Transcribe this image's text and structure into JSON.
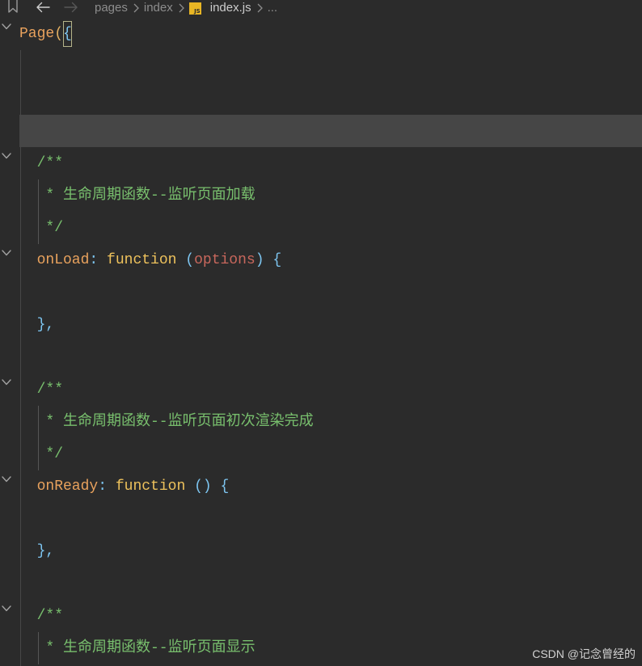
{
  "topbar": {
    "forward_enabled": false,
    "breadcrumb": {
      "folder": "pages",
      "subfolder": "index",
      "file": "index.js",
      "file_icon_text": "JS",
      "more": "..."
    }
  },
  "icons": {
    "bookmark": "bookmark-icon",
    "back": "back-arrow-icon",
    "forward": "forward-arrow-icon",
    "breadcrumb_separator": "chevron-right-icon",
    "file": "js-file-icon",
    "fold": "chevron-down-icon"
  },
  "editor": {
    "lines": [
      {
        "fold": "expanded",
        "tokens": [
          {
            "type": "identifier",
            "text": "Page"
          },
          {
            "type": "paren",
            "text": "("
          },
          {
            "type": "punctuation",
            "text": "{",
            "bracket_match": true
          }
        ]
      },
      {
        "tokens": []
      },
      {
        "tokens": []
      },
      {
        "current": true,
        "tokens": []
      },
      {
        "fold": "expanded",
        "tokens": [
          {
            "type": "comment",
            "text": "  /**"
          }
        ]
      },
      {
        "tokens": [
          {
            "type": "comment",
            "text": "   * 生命周期函数--监听页面加载"
          }
        ]
      },
      {
        "tokens": [
          {
            "type": "comment",
            "text": "   */"
          }
        ]
      },
      {
        "fold": "expanded",
        "tokens": [
          {
            "type": "identifier",
            "text": "  onLoad"
          },
          {
            "type": "punctuation",
            "text": ":"
          },
          {
            "type": "plain",
            "text": " "
          },
          {
            "type": "keyword",
            "text": "function"
          },
          {
            "type": "plain",
            "text": " "
          },
          {
            "type": "punctuation",
            "text": "("
          },
          {
            "type": "parameter",
            "text": "options"
          },
          {
            "type": "punctuation",
            "text": ")"
          },
          {
            "type": "plain",
            "text": " "
          },
          {
            "type": "punctuation",
            "text": "{"
          }
        ]
      },
      {
        "tokens": []
      },
      {
        "tokens": [
          {
            "type": "punctuation",
            "text": "  },"
          }
        ]
      },
      {
        "tokens": []
      },
      {
        "fold": "expanded",
        "tokens": [
          {
            "type": "comment",
            "text": "  /**"
          }
        ]
      },
      {
        "tokens": [
          {
            "type": "comment",
            "text": "   * 生命周期函数--监听页面初次渲染完成"
          }
        ]
      },
      {
        "tokens": [
          {
            "type": "comment",
            "text": "   */"
          }
        ]
      },
      {
        "fold": "expanded",
        "tokens": [
          {
            "type": "identifier",
            "text": "  onReady"
          },
          {
            "type": "punctuation",
            "text": ":"
          },
          {
            "type": "plain",
            "text": " "
          },
          {
            "type": "keyword",
            "text": "function"
          },
          {
            "type": "plain",
            "text": " "
          },
          {
            "type": "punctuation",
            "text": "()"
          },
          {
            "type": "plain",
            "text": " "
          },
          {
            "type": "punctuation",
            "text": "{"
          }
        ]
      },
      {
        "tokens": []
      },
      {
        "tokens": [
          {
            "type": "punctuation",
            "text": "  },"
          }
        ]
      },
      {
        "tokens": []
      },
      {
        "fold": "expanded",
        "tokens": [
          {
            "type": "comment",
            "text": "  /**"
          }
        ]
      },
      {
        "tokens": [
          {
            "type": "comment",
            "text": "   * 生命周期函数--监听页面显示"
          }
        ]
      }
    ]
  },
  "watermark": "CSDN @记念曾经的",
  "colors": {
    "background": "#2b2b2b",
    "current_line": "#464646",
    "identifier": "#e9a25d",
    "paren": "#e3b062",
    "keyword": "#eec25c",
    "punctuation": "#7dc5f0",
    "parameter": "#c8675c",
    "comment": "#78bf6d",
    "plain": "#d4d4d4",
    "bracket_match_border": "#b5b48a"
  }
}
